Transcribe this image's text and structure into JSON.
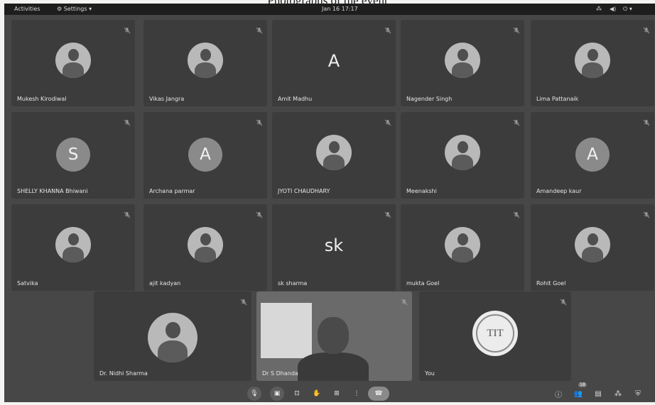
{
  "caption": "Photographs of the event",
  "topbar": {
    "activities": "Activities",
    "settings": "Settings",
    "clock": "Jan 16 17:17"
  },
  "participants": [
    {
      "name": "Mukesh Kirodiwal",
      "avatar": "photo"
    },
    {
      "name": "Vikas Jangra",
      "avatar": "photo"
    },
    {
      "name": "Amit Madhu",
      "avatar": "letter",
      "initial": "A"
    },
    {
      "name": "Nagender Singh",
      "avatar": "photo"
    },
    {
      "name": "Lima Pattanaik",
      "avatar": "photo"
    },
    {
      "name": "SHELLY KHANNA Bhiwani",
      "avatar": "letter",
      "initial": "S"
    },
    {
      "name": "Archana parmar",
      "avatar": "letter",
      "initial": "A"
    },
    {
      "name": "JYOTI CHAUDHARY",
      "avatar": "photo"
    },
    {
      "name": "Meenakshi",
      "avatar": "photo"
    },
    {
      "name": "Amandeep kaur",
      "avatar": "letter",
      "initial": "A"
    },
    {
      "name": "Satvika",
      "avatar": "photo"
    },
    {
      "name": "ajit kadyan",
      "avatar": "photo"
    },
    {
      "name": "sk sharma",
      "avatar": "letter",
      "initial": "sk"
    },
    {
      "name": "mukta Goel",
      "avatar": "photo"
    },
    {
      "name": "Rohit Goel",
      "avatar": "photo"
    }
  ],
  "bottom_row": [
    {
      "name": "Dr. Nidhi Sharma",
      "avatar": "photo"
    },
    {
      "name": "Dr S Dhanda",
      "avatar": "video"
    },
    {
      "name": "You",
      "avatar": "seal",
      "seal_text": "TIT"
    }
  ],
  "controls": {
    "participants_count": "18"
  }
}
